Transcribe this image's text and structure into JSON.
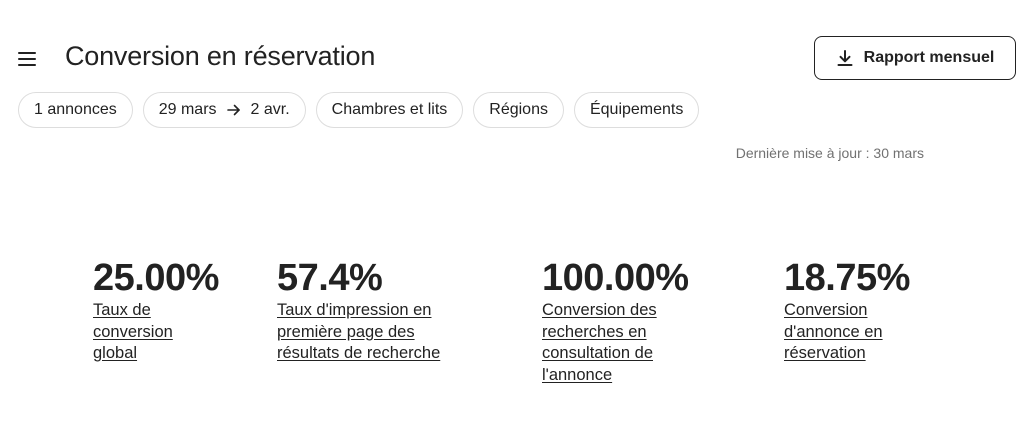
{
  "header": {
    "title": "Conversion en réservation",
    "report_button_label": "Rapport mensuel"
  },
  "filters": [
    {
      "label": "1 annonces"
    },
    {
      "date_start": "29 mars",
      "date_end": "2 avr."
    },
    {
      "label": "Chambres et lits"
    },
    {
      "label": "Régions"
    },
    {
      "label": "Équipements"
    }
  ],
  "last_update": "Dernière mise à jour : 30 mars",
  "metrics": [
    {
      "value": "25.00%",
      "label": "Taux de conversion global"
    },
    {
      "value": "57.4%",
      "label": "Taux d'impression en première page des résultats de recherche"
    },
    {
      "value": "100.00%",
      "label": "Conversion des recherches en consultation de l'annonce"
    },
    {
      "value": "18.75%",
      "label": "Conversion d'annonce en réservation"
    }
  ],
  "icons": {
    "menu": "menu-icon",
    "download": "download-icon",
    "arrow": "arrow-right-icon"
  }
}
